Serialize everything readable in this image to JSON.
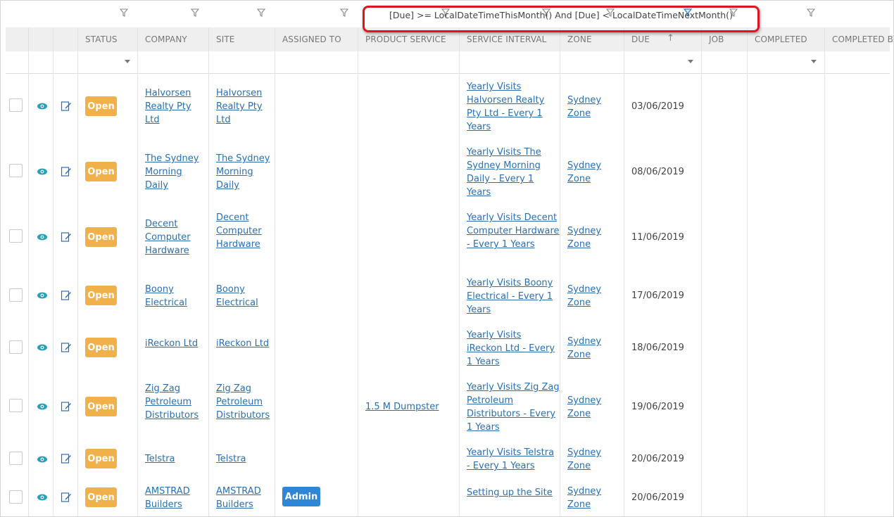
{
  "filter": {
    "expression": "[Due] >= LocalDateTimeThisMonth() And [Due] < LocalDateTimeNextMonth()"
  },
  "columns": {
    "status": "STATUS",
    "company": "COMPANY",
    "site": "SITE",
    "assigned_to": "ASSIGNED TO",
    "product_service": "PRODUCT SERVICE",
    "service_interval": "SERVICE INTERVAL",
    "zone": "ZONE",
    "due": "DUE",
    "job": "JOB",
    "completed": "COMPLETED",
    "completed_by": "COMPLETED BY"
  },
  "rows": [
    {
      "status": "Open",
      "company": "Halvorsen Realty Pty Ltd",
      "site": "Halvorsen Realty Pty Ltd",
      "assigned": "",
      "product": "",
      "interval": "Yearly Visits Halvorsen Realty Pty Ltd - Every 1 Years",
      "zone": "Sydney Zone",
      "due": "03/06/2019"
    },
    {
      "status": "Open",
      "company": "The Sydney Morning Daily",
      "site": "The Sydney Morning Daily",
      "assigned": "",
      "product": "",
      "interval": "Yearly Visits The Sydney Morning Daily - Every 1 Years",
      "zone": "Sydney Zone",
      "due": "08/06/2019"
    },
    {
      "status": "Open",
      "company": "Decent Computer Hardware",
      "site": "Decent Computer Hardware",
      "assigned": "",
      "product": "",
      "interval": "Yearly Visits Decent Computer Hardware - Every 1 Years",
      "zone": "Sydney Zone",
      "due": "11/06/2019"
    },
    {
      "status": "Open",
      "company": "Boony Electrical",
      "site": "Boony Electrical",
      "assigned": "",
      "product": "",
      "interval": "Yearly Visits Boony Electrical - Every 1 Years",
      "zone": "Sydney Zone",
      "due": "17/06/2019"
    },
    {
      "status": "Open",
      "company": "iReckon Ltd",
      "site": "iReckon Ltd",
      "assigned": "",
      "product": "",
      "interval": "Yearly Visits iReckon Ltd - Every 1 Years",
      "zone": "Sydney Zone",
      "due": "18/06/2019"
    },
    {
      "status": "Open",
      "company": "Zig Zag Petroleum Distributors",
      "site": "Zig Zag Petroleum Distributors",
      "assigned": "",
      "product": "1.5 M Dumpster",
      "interval": "Yearly Visits Zig Zag Petroleum Distributors - Every 1 Years",
      "zone": "Sydney Zone",
      "due": "19/06/2019"
    },
    {
      "status": "Open",
      "company": "Telstra",
      "site": "Telstra",
      "assigned": "",
      "product": "",
      "interval": "Yearly Visits Telstra - Every 1 Years",
      "zone": "Sydney Zone",
      "due": "20/06/2019"
    },
    {
      "status": "Open",
      "company": "AMSTRAD Builders",
      "site": "AMSTRAD Builders",
      "assigned": "Admin",
      "product": "",
      "interval": "Setting up the Site",
      "zone": "Sydney Zone",
      "due": "20/06/2019"
    }
  ],
  "icons": {
    "view": "eye-icon",
    "edit": "edit-icon",
    "filter": "funnel-icon",
    "sort": "sort-up-arrow-icon"
  },
  "colors": {
    "open_badge": "#f0b04a",
    "admin_badge": "#2f86d6",
    "link": "#2a6fb3",
    "highlight": "#e0141e"
  }
}
